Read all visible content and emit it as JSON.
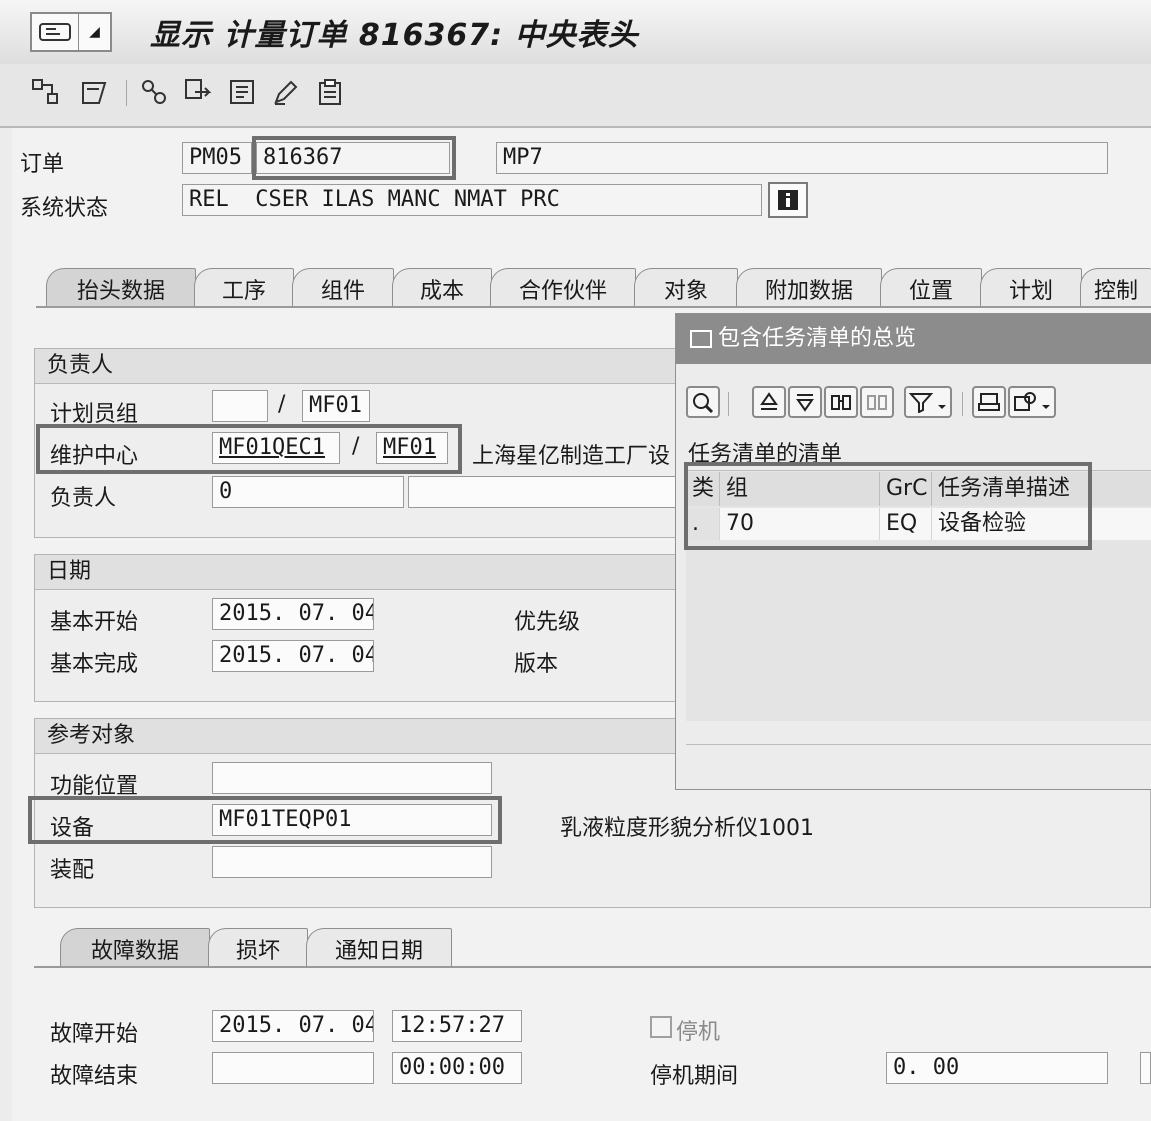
{
  "title": "显示 计量订单 816367: 中央表头",
  "order": {
    "label": "订单",
    "type": "PM05",
    "number": "816367",
    "text": "MP7"
  },
  "system_status": {
    "label": "系统状态",
    "value": "REL  CSER ILAS MANC NMAT PRC"
  },
  "tabs": [
    "抬头数据",
    "工序",
    "组件",
    "成本",
    "合作伙伴",
    "对象",
    "附加数据",
    "位置",
    "计划",
    "控制"
  ],
  "responsible": {
    "header": "负责人",
    "planner_group_label": "计划员组",
    "planner_group_value": "",
    "planner_plant": "MF01",
    "work_center_label": "维护中心",
    "work_center": "MF01QEC1",
    "work_center_plant": "MF01",
    "work_center_desc": "上海星亿制造工厂设",
    "person_label": "负责人",
    "person_value": "0",
    "slash": "/"
  },
  "dates": {
    "header": "日期",
    "basic_start_label": "基本开始",
    "basic_start": "2015. 07. 04",
    "basic_finish_label": "基本完成",
    "basic_finish": "2015. 07. 04",
    "priority_label": "优先级",
    "revision_label": "版本"
  },
  "reference": {
    "header": "参考对象",
    "func_loc_label": "功能位置",
    "func_loc": "",
    "equipment_label": "设备",
    "equipment": "MF01TEQP01",
    "equipment_desc": "乳液粒度形貌分析仪1001",
    "assembly_label": "装配",
    "assembly": ""
  },
  "subtabs": [
    "故障数据",
    "损坏",
    "通知日期"
  ],
  "malfunction": {
    "start_label": "故障开始",
    "start_date": "2015. 07. 04",
    "start_time": "12:57:27",
    "end_label": "故障结束",
    "end_date": "",
    "end_time": "00:00:00",
    "breakdown_label": "停机",
    "duration_label": "停机期间",
    "duration": "0. 00"
  },
  "popup": {
    "title": "包含任务清单的总览",
    "list_title": "任务清单的清单",
    "columns": [
      "类",
      "组",
      "GrC",
      "任务清单描述"
    ],
    "rows": [
      {
        "type": ".",
        "group": "70",
        "grc": "EQ",
        "desc": "设备检验"
      }
    ]
  },
  "colors": {
    "highlight_border": "#6e6e6e",
    "popup_titlebar": "#8c8c8c"
  }
}
